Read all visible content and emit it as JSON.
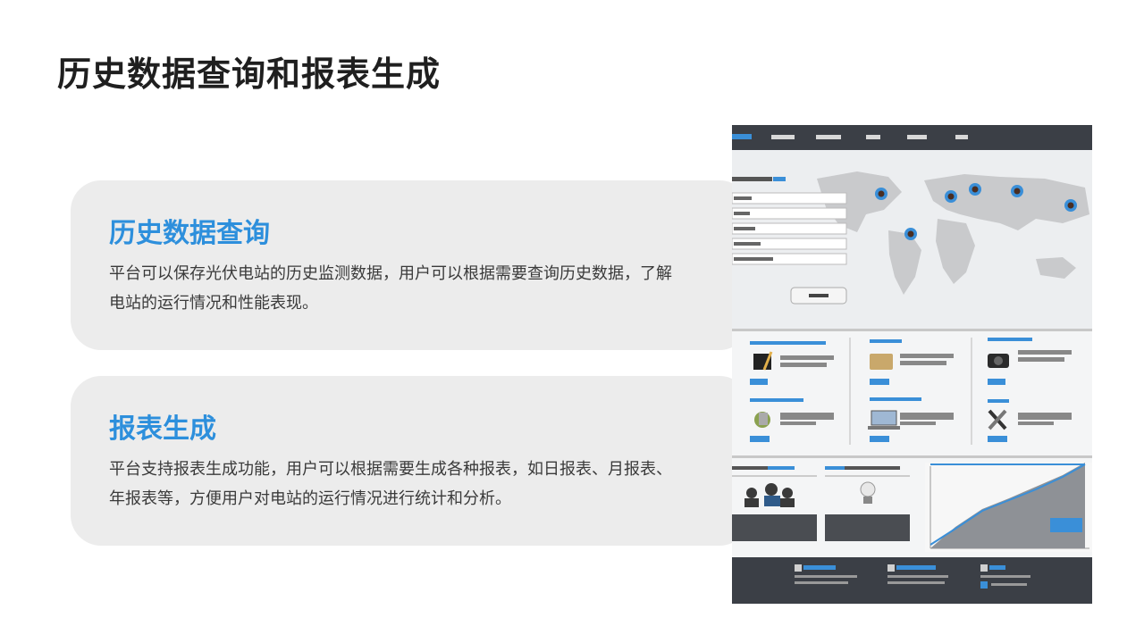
{
  "page": {
    "title": "历史数据查询和报表生成"
  },
  "sections": [
    {
      "heading": "历史数据查询",
      "body": "平台可以保存光伏电站的历史监测数据，用户可以根据需要查询历史数据，了解电站的运行情况和性能表现。"
    },
    {
      "heading": "报表生成",
      "body": "平台支持报表生成功能，用户可以根据需要生成各种报表，如日报表、月报表、年报表等，方便用户对电站的运行情况进行统计和分析。"
    }
  ],
  "illustration": {
    "kind": "dashboard-screenshot-image",
    "colors": {
      "nav_bar": "#3b3f46",
      "accent": "#3a8fd8",
      "map": "#c9cacc",
      "footer": "#3b3f46"
    },
    "icons": [
      "location-pin-icon",
      "pen-icon",
      "folder-icon",
      "camera-icon",
      "tools-icon",
      "laptop-icon",
      "people-icon",
      "lightbulb-icon",
      "line-chart-icon"
    ]
  }
}
